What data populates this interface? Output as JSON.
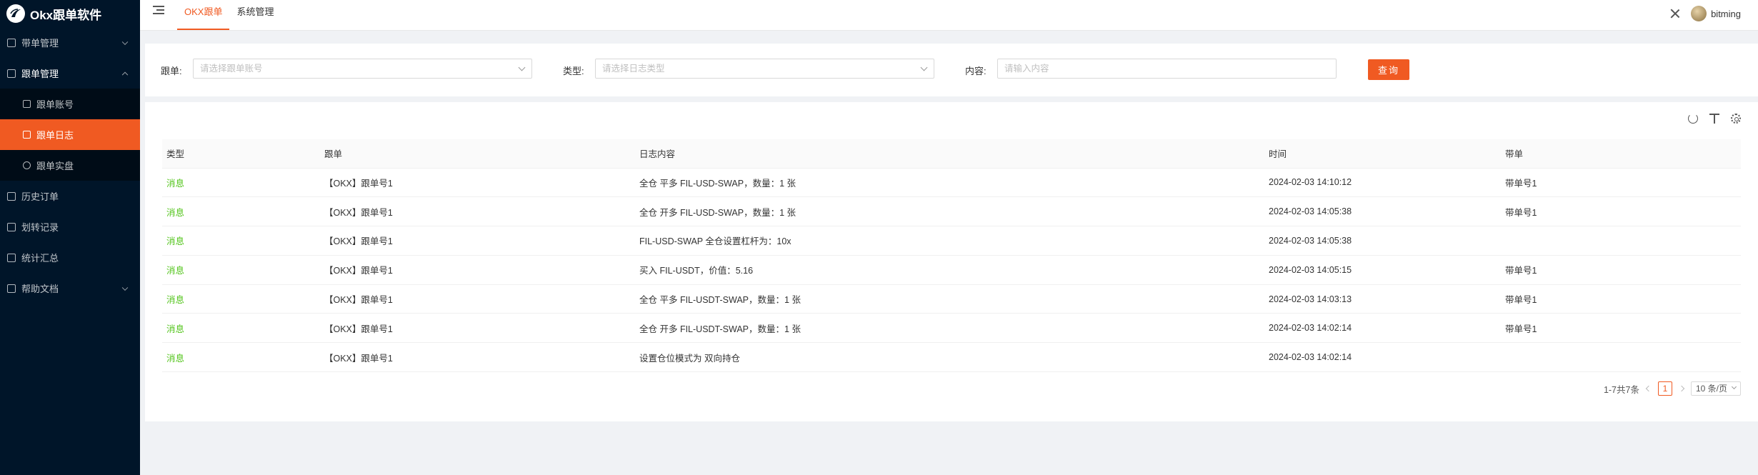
{
  "app": {
    "title": "Okx跟单软件"
  },
  "sidebar": {
    "items": [
      {
        "label": "带单管理"
      },
      {
        "label": "跟单管理",
        "children": [
          {
            "label": "跟单账号"
          },
          {
            "label": "跟单日志"
          },
          {
            "label": "跟单实盘"
          }
        ]
      },
      {
        "label": "历史订单"
      },
      {
        "label": "划转记录"
      },
      {
        "label": "统计汇总"
      },
      {
        "label": "帮助文档"
      }
    ]
  },
  "header": {
    "tabs": [
      {
        "label": "OKX跟单"
      },
      {
        "label": "系统管理"
      }
    ],
    "username": "bitming"
  },
  "search": {
    "account_label": "跟单:",
    "account_placeholder": "请选择跟单账号",
    "type_label": "类型:",
    "type_placeholder": "请选择日志类型",
    "content_label": "内容:",
    "content_placeholder": "请输入内容",
    "query_button": "查询"
  },
  "table": {
    "columns": [
      "类型",
      "跟单",
      "日志内容",
      "时间",
      "带单"
    ],
    "rows": [
      {
        "type": "消息",
        "account": "【OKX】跟单号1",
        "content": "全仓 平多 FIL-USD-SWAP，数量：1 张",
        "time": "2024-02-03 14:10:12",
        "leader": "带单号1"
      },
      {
        "type": "消息",
        "account": "【OKX】跟单号1",
        "content": "全仓 开多 FIL-USD-SWAP，数量：1 张",
        "time": "2024-02-03 14:05:38",
        "leader": "带单号1"
      },
      {
        "type": "消息",
        "account": "【OKX】跟单号1",
        "content": "FIL-USD-SWAP 全仓设置杠杆为：10x",
        "time": "2024-02-03 14:05:38",
        "leader": ""
      },
      {
        "type": "消息",
        "account": "【OKX】跟单号1",
        "content": "买入 FIL-USDT，价值：5.16",
        "time": "2024-02-03 14:05:15",
        "leader": "带单号1"
      },
      {
        "type": "消息",
        "account": "【OKX】跟单号1",
        "content": "全仓 平多 FIL-USDT-SWAP，数量：1 张",
        "time": "2024-02-03 14:03:13",
        "leader": "带单号1"
      },
      {
        "type": "消息",
        "account": "【OKX】跟单号1",
        "content": "全仓 开多 FIL-USDT-SWAP，数量：1 张",
        "time": "2024-02-03 14:02:14",
        "leader": "带单号1"
      },
      {
        "type": "消息",
        "account": "【OKX】跟单号1",
        "content": "设置仓位模式为 双向持仓",
        "time": "2024-02-03 14:02:14",
        "leader": ""
      }
    ]
  },
  "pagination": {
    "total_text": "1-7共7条",
    "current_page": "1",
    "page_size": "10 条/页"
  },
  "colors": {
    "accent": "#f05a22",
    "sidebar_bg": "#001529",
    "message_green": "#52c41a"
  }
}
